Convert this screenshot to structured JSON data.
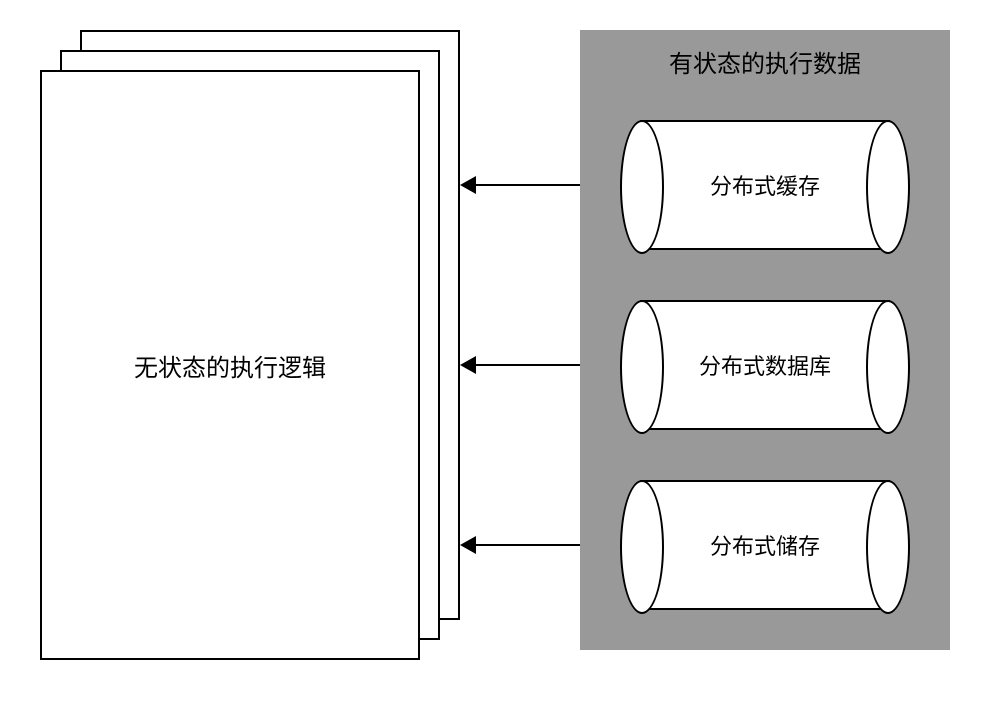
{
  "left": {
    "label": "无状态的执行逻辑"
  },
  "right": {
    "title": "有状态的执行数据",
    "cylinders": [
      {
        "label": "分布式缓存"
      },
      {
        "label": "分布式数据库"
      },
      {
        "label": "分布式储存"
      }
    ]
  }
}
